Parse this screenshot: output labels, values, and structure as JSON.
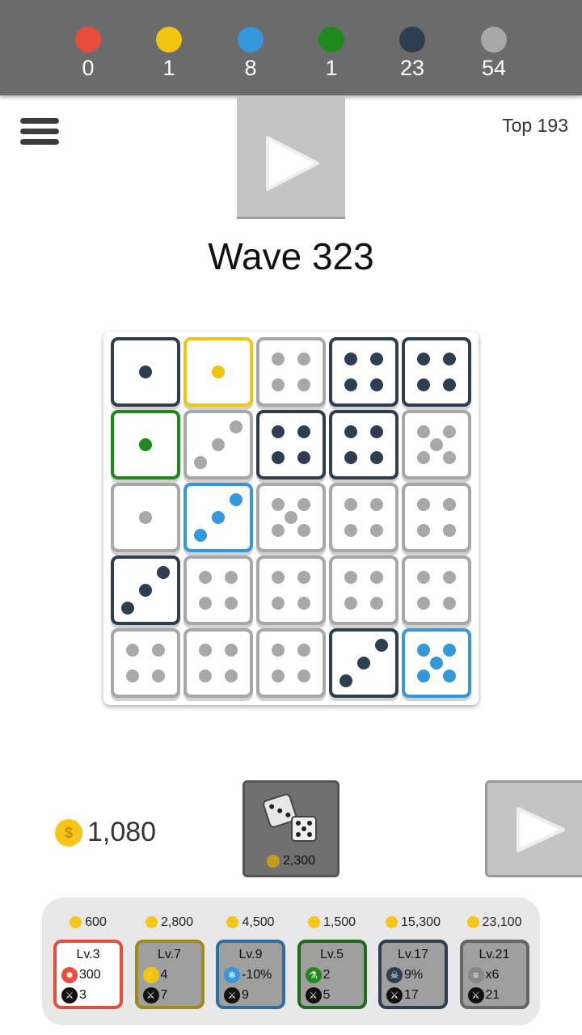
{
  "counters": [
    {
      "color": "#e74c3c",
      "value": "0"
    },
    {
      "color": "#f1c40f",
      "value": "1"
    },
    {
      "color": "#3498db",
      "value": "8"
    },
    {
      "color": "#1e8a1e",
      "value": "1"
    },
    {
      "color": "#2c3e50",
      "value": "23"
    },
    {
      "color": "#a8a8a8",
      "value": "54"
    }
  ],
  "rank_label": "Top 193",
  "wave_label": "Wave 323",
  "colors": {
    "red": "#e74c3c",
    "yellow": "#f1c40f",
    "blue": "#3498db",
    "green": "#1e8a1e",
    "navy": "#2c3e50",
    "gray": "#a8a8a8"
  },
  "board": [
    [
      {
        "c": "navy",
        "v": 1
      },
      {
        "c": "yellow",
        "v": 1
      },
      {
        "c": "gray",
        "v": 4
      },
      {
        "c": "navy",
        "v": 4
      },
      {
        "c": "navy",
        "v": 4
      }
    ],
    [
      {
        "c": "green",
        "v": 1
      },
      {
        "c": "gray",
        "v": 3
      },
      {
        "c": "navy",
        "v": 4
      },
      {
        "c": "navy",
        "v": 4
      },
      {
        "c": "gray",
        "v": 5
      }
    ],
    [
      {
        "c": "gray",
        "v": 1
      },
      {
        "c": "blue",
        "v": 3
      },
      {
        "c": "gray",
        "v": 5
      },
      {
        "c": "gray",
        "v": 4
      },
      {
        "c": "gray",
        "v": 4
      }
    ],
    [
      {
        "c": "navy",
        "v": 3
      },
      {
        "c": "gray",
        "v": 4
      },
      {
        "c": "gray",
        "v": 4
      },
      {
        "c": "gray",
        "v": 4
      },
      {
        "c": "gray",
        "v": 4
      }
    ],
    [
      {
        "c": "gray",
        "v": 4
      },
      {
        "c": "gray",
        "v": 4
      },
      {
        "c": "gray",
        "v": 4
      },
      {
        "c": "navy",
        "v": 3
      },
      {
        "c": "blue",
        "v": 5
      }
    ]
  ],
  "coins": "1,080",
  "roll_cost": "2,300",
  "upgrades": [
    {
      "cost": "600",
      "color": "#e74c3c",
      "level": "Lv.3",
      "stat": "300",
      "stat_icon": "fire-icon",
      "icon_color": "#e74c3c",
      "power": "3"
    },
    {
      "cost": "2,800",
      "color": "#a08a1a",
      "level": "Lv.7",
      "stat": "4",
      "stat_icon": "lightning-icon",
      "icon_color": "#f1c40f",
      "power": "7"
    },
    {
      "cost": "4,500",
      "color": "#2f6fa0",
      "level": "Lv.9",
      "stat": "-10%",
      "stat_icon": "snowflake-icon",
      "icon_color": "#3498db",
      "power": "9"
    },
    {
      "cost": "1,500",
      "color": "#1e6a1e",
      "level": "Lv.5",
      "stat": "2",
      "stat_icon": "poison-flask-icon",
      "icon_color": "#1e8a1e",
      "power": "5"
    },
    {
      "cost": "15,300",
      "color": "#2c3e50",
      "level": "Lv.17",
      "stat": "9%",
      "stat_icon": "skull-icon",
      "icon_color": "#2c3e50",
      "power": "17"
    },
    {
      "cost": "23,100",
      "color": "#666666",
      "level": "Lv.21",
      "stat": "x6",
      "stat_icon": "multishot-icon",
      "icon_color": "#888888",
      "power": "21"
    }
  ]
}
